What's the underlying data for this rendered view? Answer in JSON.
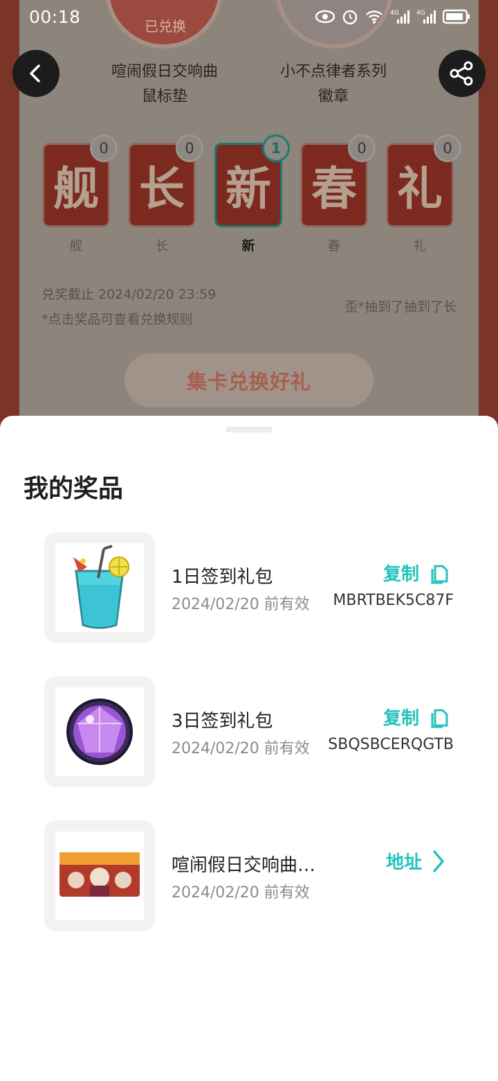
{
  "status_bar": {
    "time": "00:18"
  },
  "background": {
    "redeemed_label": "已兑换",
    "prizes": [
      {
        "line1": "喧闹假日交响曲",
        "line2": "鼠标垫"
      },
      {
        "line1": "小不点律者系列",
        "line2": "徽章"
      }
    ],
    "cards": [
      {
        "glyph": "舰",
        "count": "0",
        "label": "舰",
        "active": false
      },
      {
        "glyph": "长",
        "count": "0",
        "label": "长",
        "active": false
      },
      {
        "glyph": "新",
        "count": "1",
        "label": "新",
        "active": true
      },
      {
        "glyph": "春",
        "count": "0",
        "label": "春",
        "active": false
      },
      {
        "glyph": "礼",
        "count": "0",
        "label": "礼",
        "active": false
      }
    ],
    "deadline": "兑奖截止 2024/02/20 23:59",
    "hint": "*点击奖品可查看兑换规则",
    "winner_marquee": "歪*抽到了抽到了长",
    "exchange_button": "集卡兑换好礼"
  },
  "sheet": {
    "title": "我的奖品",
    "items": [
      {
        "name": "1日签到礼包",
        "validity": "2024/02/20 前有效",
        "code": "MBRTBEK5C87F",
        "action": "复制",
        "action_icon": "copy-icon"
      },
      {
        "name": "3日签到礼包",
        "validity": "2024/02/20 前有效",
        "code": "SBQSBCERQGTB",
        "action": "复制",
        "action_icon": "copy-icon"
      },
      {
        "name": "喧闹假日交响曲…",
        "validity": "2024/02/20 前有效",
        "code": "",
        "action": "地址",
        "action_icon": "chevron-right-icon"
      }
    ]
  },
  "colors": {
    "accent": "#22c3bb",
    "dimmed_background": "#8d857c"
  }
}
